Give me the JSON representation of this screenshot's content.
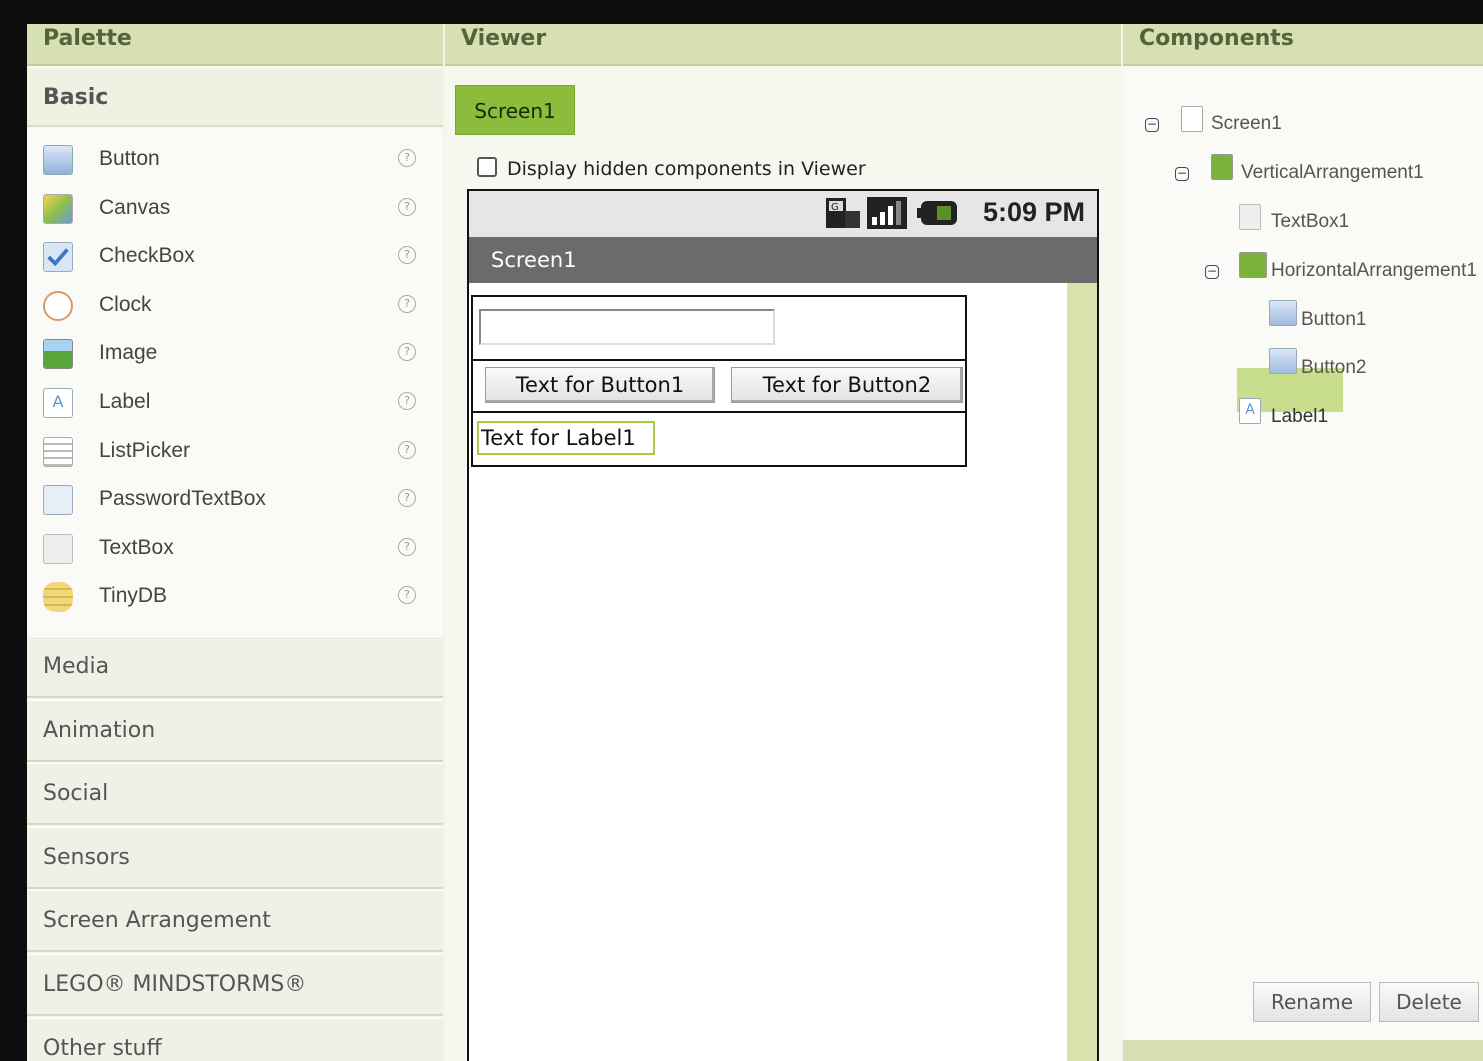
{
  "palette": {
    "title": "Palette",
    "basic_title": "Basic",
    "items": [
      {
        "label": "Button",
        "icon": "button-icon"
      },
      {
        "label": "Canvas",
        "icon": "canvas-icon"
      },
      {
        "label": "CheckBox",
        "icon": "checkbox-icon"
      },
      {
        "label": "Clock",
        "icon": "clock-icon"
      },
      {
        "label": "Image",
        "icon": "image-icon"
      },
      {
        "label": "Label",
        "icon": "label-icon"
      },
      {
        "label": "ListPicker",
        "icon": "listpicker-icon"
      },
      {
        "label": "PasswordTextBox",
        "icon": "password-textbox-icon"
      },
      {
        "label": "TextBox",
        "icon": "textbox-icon"
      },
      {
        "label": "TinyDB",
        "icon": "tinydb-icon"
      }
    ],
    "help_glyph": "?",
    "drawers": [
      "Media",
      "Animation",
      "Social",
      "Sensors",
      "Screen Arrangement",
      "LEGO® MINDSTORMS®",
      "Other stuff"
    ]
  },
  "viewer": {
    "title": "Viewer",
    "screen_tab": "Screen1",
    "hidden_checkbox_label": "Display hidden components in Viewer",
    "hidden_checkbox_checked": false,
    "phone": {
      "time": "5:09 PM",
      "screen_title": "Screen1",
      "textbox_value": "",
      "button1_text": "Text for Button1",
      "button2_text": "Text for Button2",
      "label1_text": "Text for Label1"
    }
  },
  "components": {
    "title": "Components",
    "tree": {
      "screen": "Screen1",
      "vertical": "VerticalArrangement1",
      "textbox": "TextBox1",
      "horizontal": "HorizontalArrangement1",
      "button1": "Button1",
      "button2": "Button2",
      "label1": "Label1"
    },
    "rename_label": "Rename",
    "delete_label": "Delete"
  },
  "colors": {
    "header_bg": "#d6e0b3",
    "accent_green": "#8cbc3c",
    "selection_green": "#c9de8d"
  }
}
